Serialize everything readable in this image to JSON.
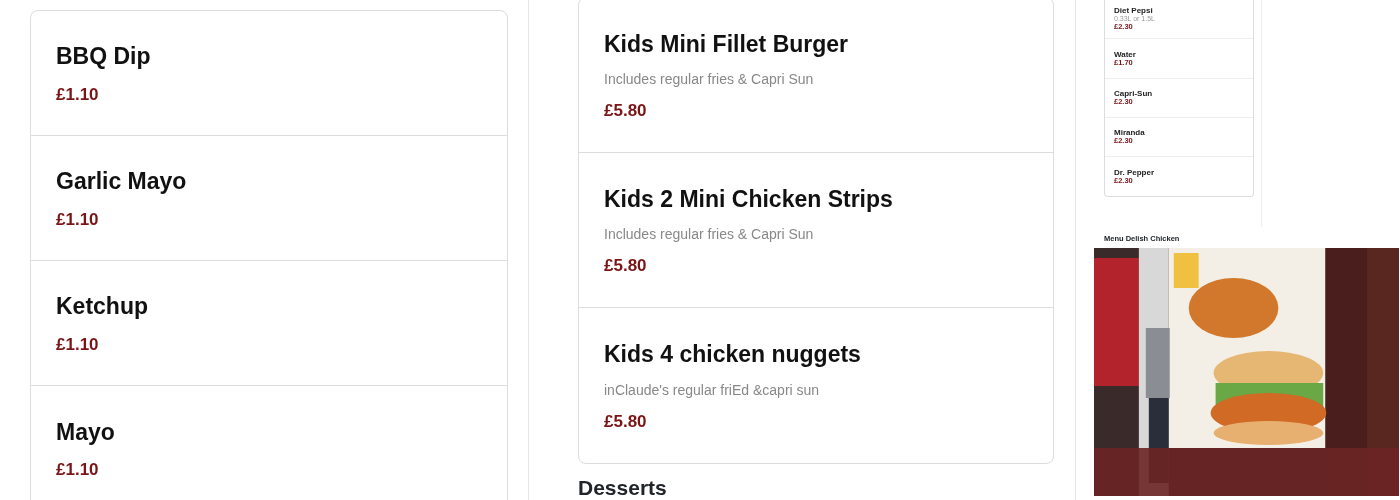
{
  "sauces": {
    "items": [
      {
        "name": "BBQ Dip",
        "price": "£1.10"
      },
      {
        "name": "Garlic Mayo",
        "price": "£1.10"
      },
      {
        "name": "Ketchup",
        "price": "£1.10"
      },
      {
        "name": "Mayo",
        "price": "£1.10"
      }
    ]
  },
  "kids_menu": {
    "items": [
      {
        "name": "Kids Mini Fillet Burger",
        "description": "Includes regular fries & Capri Sun",
        "price": "£5.80"
      },
      {
        "name": "Kids 2 Mini Chicken Strips",
        "description": "Includes regular fries & Capri Sun",
        "price": "£5.80"
      },
      {
        "name": "Kids 4 chicken nuggets",
        "description": "inClaude's regular friEd &capri sun",
        "price": "£5.80"
      }
    ]
  },
  "desserts": {
    "heading": "Desserts"
  },
  "drinks": {
    "items": [
      {
        "name": "Diet Pepsi",
        "description": "0.33L or 1.5L",
        "price": "£2.30"
      },
      {
        "name": "Water",
        "price": "£1.70"
      },
      {
        "name": "Capri-Sun",
        "price": "£2.30"
      },
      {
        "name": "Miranda",
        "price": "£2.30"
      },
      {
        "name": "Dr. Pepper",
        "price": "£2.30"
      }
    ]
  },
  "gallery": {
    "caption": "Menu Delish Chicken"
  }
}
